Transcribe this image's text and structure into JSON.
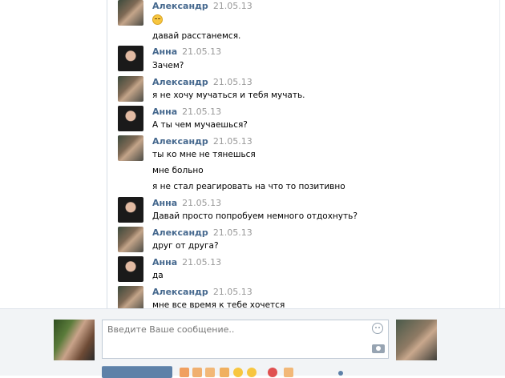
{
  "messages": [
    {
      "author": "Александр",
      "date": "21.05.13",
      "avatar": "alexander",
      "lines": [
        "давай расстанемся."
      ],
      "emoji": "pensive-face"
    },
    {
      "author": "Анна",
      "date": "21.05.13",
      "avatar": "anna",
      "lines": [
        "Зачем?"
      ]
    },
    {
      "author": "Александр",
      "date": "21.05.13",
      "avatar": "alexander",
      "lines": [
        "я не хочу мучаться и тебя мучать."
      ]
    },
    {
      "author": "Анна",
      "date": "21.05.13",
      "avatar": "anna",
      "lines": [
        "А ты чем мучаешься?"
      ]
    },
    {
      "author": "Александр",
      "date": "21.05.13",
      "avatar": "alexander",
      "lines": [
        "ты ко мне не тянешься",
        "мне больно",
        "я не стал реагировать на что то позитивно"
      ]
    },
    {
      "author": "Анна",
      "date": "21.05.13",
      "avatar": "anna",
      "lines": [
        "Давай просто попробуем немного отдохнуть?"
      ]
    },
    {
      "author": "Александр",
      "date": "21.05.13",
      "avatar": "alexander",
      "lines": [
        "друг от друга?"
      ]
    },
    {
      "author": "Анна",
      "date": "21.05.13",
      "avatar": "anna",
      "lines": [
        "да"
      ]
    },
    {
      "author": "Александр",
      "date": "21.05.13",
      "avatar": "alexander",
      "lines": [
        "мне все время к тебе хочется"
      ]
    }
  ],
  "composer": {
    "placeholder": "Введите Ваше сообщение..",
    "icons": [
      "smile-icon",
      "camera-icon"
    ]
  },
  "colors": {
    "author": "#45688e",
    "date": "#999999",
    "panel": "#f2f4f6",
    "button": "#5e81a8"
  }
}
